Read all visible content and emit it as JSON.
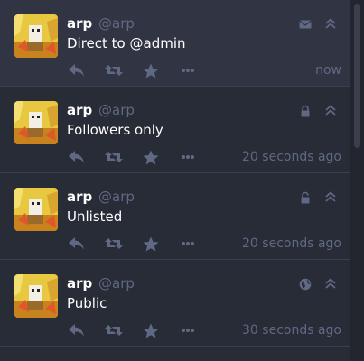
{
  "colors": {
    "background": "#282c37",
    "highlight": "#313543",
    "muted": "#606984",
    "text": "#ffffff"
  },
  "statuses": [
    {
      "display_name": "arp",
      "acct": "@arp",
      "content": "Direct to @admin",
      "visibility_icon": "envelope-icon",
      "time": "now"
    },
    {
      "display_name": "arp",
      "acct": "@arp",
      "content": "Followers only",
      "visibility_icon": "lock-icon",
      "time": "20 seconds ago"
    },
    {
      "display_name": "arp",
      "acct": "@arp",
      "content": "Unlisted",
      "visibility_icon": "unlock-icon",
      "time": "20 seconds ago"
    },
    {
      "display_name": "arp",
      "acct": "@arp",
      "content": "Public",
      "visibility_icon": "globe-icon",
      "time": "30 seconds ago"
    }
  ]
}
